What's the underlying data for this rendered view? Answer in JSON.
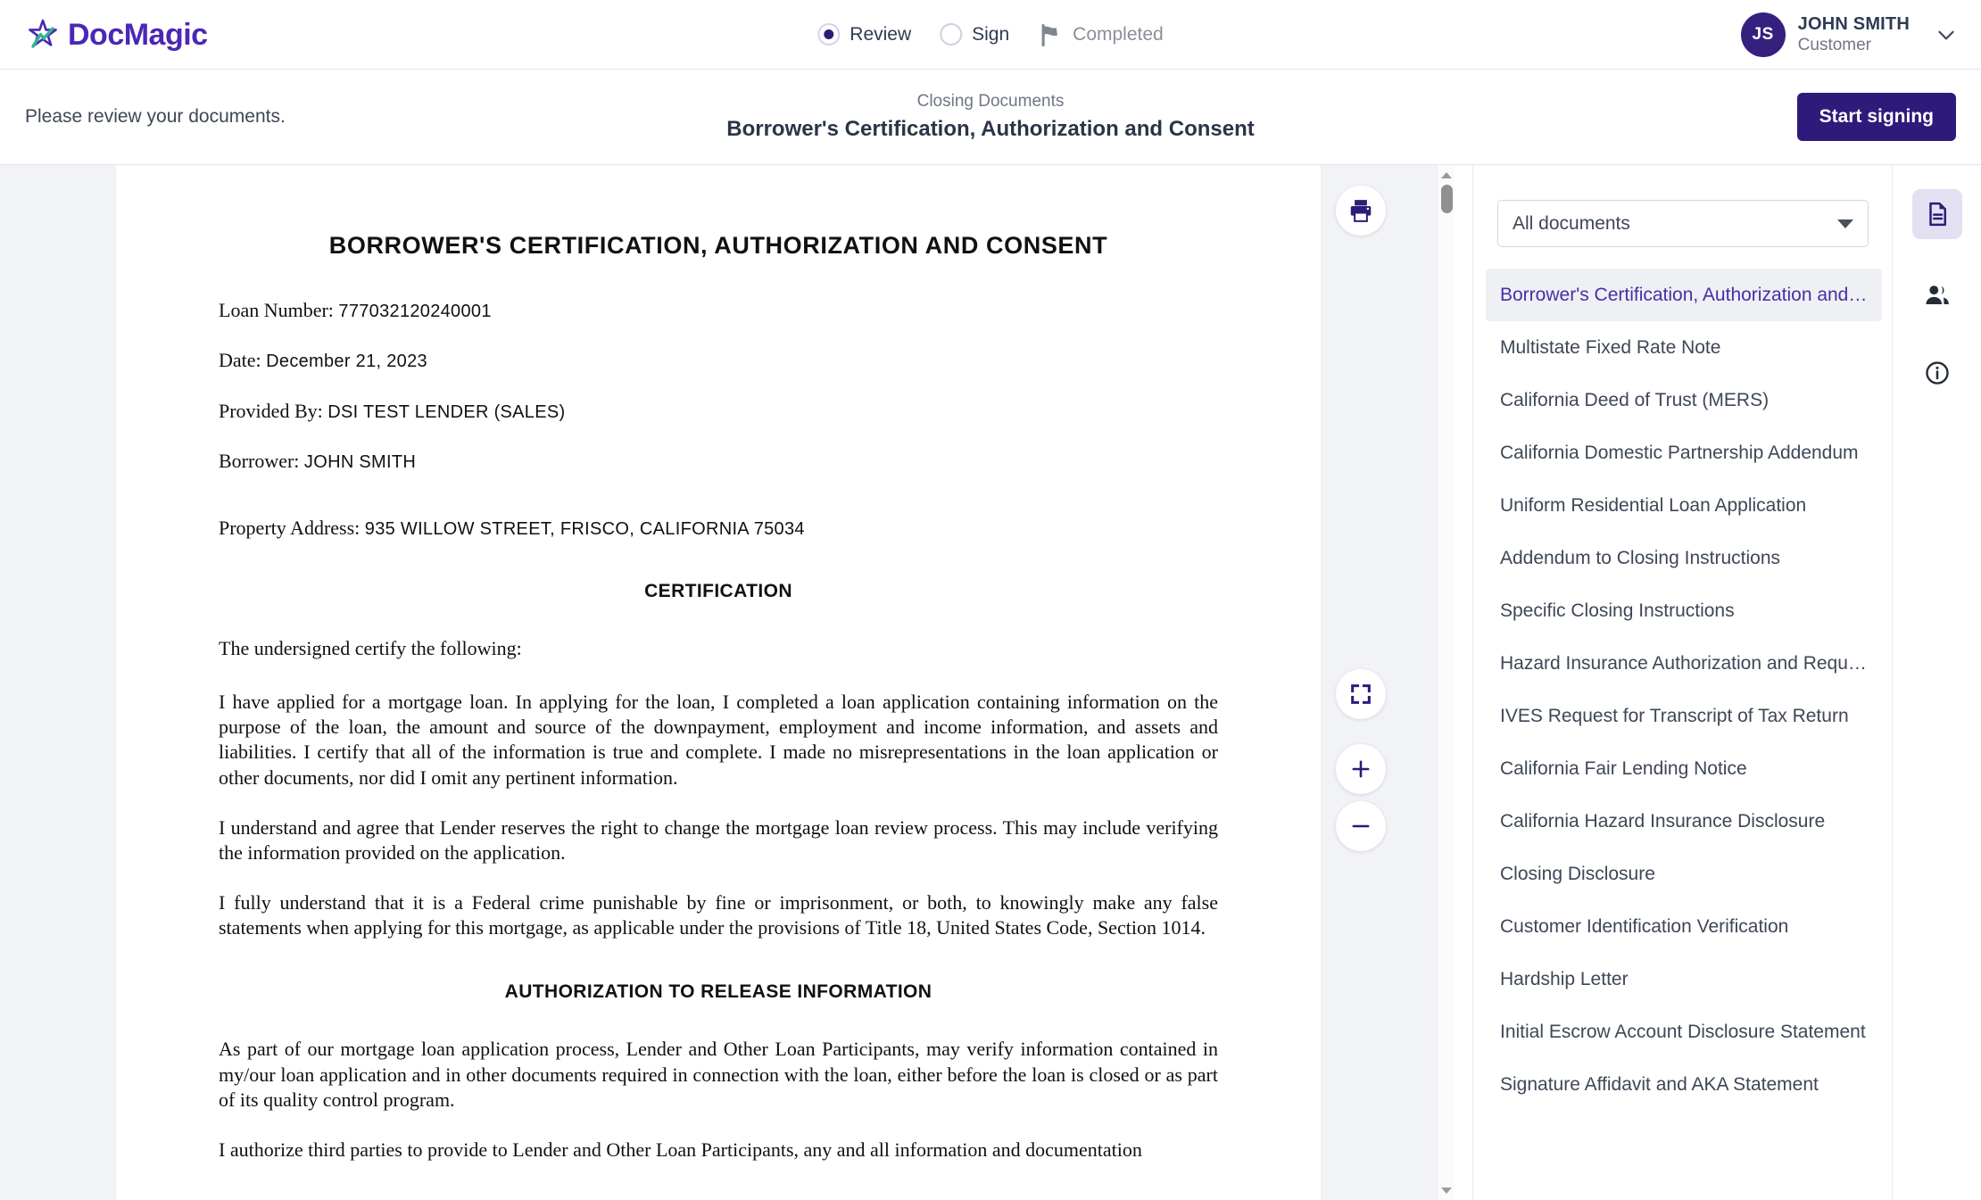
{
  "brand": {
    "name": "DocMagic",
    "logo_color": "#4b27b5",
    "accent_green": "#2eb88a"
  },
  "header": {
    "steps": [
      {
        "label": "Review",
        "state": "active",
        "icon": "radio-filled-icon"
      },
      {
        "label": "Sign",
        "state": "inactive",
        "icon": "radio-empty-icon"
      },
      {
        "label": "Completed",
        "state": "disabled",
        "icon": "flag-icon"
      }
    ],
    "profile": {
      "initials": "JS",
      "name": "JOHN SMITH",
      "role": "Customer",
      "menu_icon": "chevron-down-icon",
      "avatar_color": "#35207e"
    }
  },
  "subheader": {
    "note": "Please review your documents.",
    "eyebrow": "Closing Documents",
    "title": "Borrower's Certification, Authorization and Consent",
    "start_button": "Start signing",
    "start_button_color": "#2e1a7a"
  },
  "viewer": {
    "tools": [
      {
        "name": "print-button",
        "icon": "print-icon"
      },
      {
        "name": "fullscreen-button",
        "icon": "fullscreen-icon"
      },
      {
        "name": "zoom-in-button",
        "icon": "plus-icon"
      },
      {
        "name": "zoom-out-button",
        "icon": "minus-icon"
      }
    ]
  },
  "document": {
    "title": "BORROWER'S CERTIFICATION, AUTHORIZATION AND CONSENT",
    "fields": [
      {
        "label": "Loan Number:",
        "value": "777032120240001"
      },
      {
        "label": "Date:",
        "value": "December 21, 2023"
      },
      {
        "label": "Provided By:",
        "value": "DSI TEST LENDER (SALES)"
      },
      {
        "label": "Borrower:",
        "value": "JOHN SMITH"
      }
    ],
    "property": {
      "label": "Property Address:",
      "value": "935 WILLOW STREET, FRISCO, CALIFORNIA 75034"
    },
    "section1_heading": "CERTIFICATION",
    "lead": "The undersigned certify the following:",
    "paragraphs_1": [
      "I have applied for a mortgage loan. In applying for the loan, I completed a loan application containing information on the purpose of the loan, the amount and source of the downpayment, employment and income information, and assets and liabilities. I certify that all of the information is true and complete. I made no misrepresentations in the loan application or other documents, nor did I omit any pertinent information.",
      "I understand and agree that Lender reserves the right to change the mortgage loan review process. This may include verifying the information provided on the application.",
      "I fully understand that it is a Federal crime punishable by fine or imprisonment, or both, to knowingly make any false statements when applying for this mortgage, as applicable under the provisions of Title 18, United States Code, Section 1014."
    ],
    "section2_heading": "AUTHORIZATION TO RELEASE INFORMATION",
    "paragraphs_2": [
      "As part of our mortgage loan application process, Lender and Other Loan Participants, may verify information contained in my/our loan application and in other documents required in connection with the loan, either before the loan is closed or as part of its quality control program.",
      "I authorize third parties to provide to Lender and Other Loan Participants, any and all information and documentation"
    ]
  },
  "docpanel": {
    "filter_value": "All documents",
    "filter_icon": "chevron-down-icon",
    "selected_index": 0,
    "items": [
      "Borrower's Certification, Authorization and Consent",
      "Multistate Fixed Rate Note",
      "California Deed of Trust (MERS)",
      "California Domestic Partnership Addendum",
      "Uniform Residential Loan Application",
      "Addendum to Closing Instructions",
      "Specific Closing Instructions",
      "Hazard Insurance Authorization and Requirements",
      "IVES Request for Transcript of Tax Return",
      "California Fair Lending Notice",
      "California Hazard Insurance Disclosure",
      "Closing Disclosure",
      "Customer Identification Verification",
      "Hardship Letter",
      "Initial Escrow Account Disclosure Statement",
      "Signature Affidavit and AKA Statement"
    ]
  },
  "rail": {
    "items": [
      {
        "name": "documents-tab",
        "icon": "document-icon",
        "active": true
      },
      {
        "name": "participants-tab",
        "icon": "people-icon",
        "active": false
      },
      {
        "name": "info-tab",
        "icon": "info-icon",
        "active": false
      }
    ]
  }
}
